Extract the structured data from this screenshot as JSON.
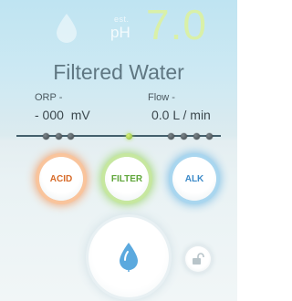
{
  "display": {
    "est_label": "est.",
    "ph_label": "pH",
    "ph_value": "7.0"
  },
  "mode": {
    "title": "Filtered Water"
  },
  "readings": {
    "orp_label": "ORP -",
    "orp_value": "- 000  mV",
    "flow_label": "Flow -",
    "flow_value": "0.0 L / min"
  },
  "indicator": {
    "active_color": "#9bd04a",
    "inactive_color": "#4a5357",
    "dots": [
      "inactive",
      "inactive",
      "inactive",
      "active",
      "inactive",
      "inactive",
      "inactive",
      "inactive"
    ]
  },
  "buttons": {
    "acid": {
      "label": "ACID",
      "color": "#f2a878"
    },
    "filter": {
      "label": "FILTER",
      "color": "#a4d878"
    },
    "alk": {
      "label": "ALK",
      "color": "#86c2e6"
    }
  },
  "icons": {
    "top_drop": "water-drop-icon",
    "main": "water-drop-icon",
    "lock": "unlock-icon"
  }
}
